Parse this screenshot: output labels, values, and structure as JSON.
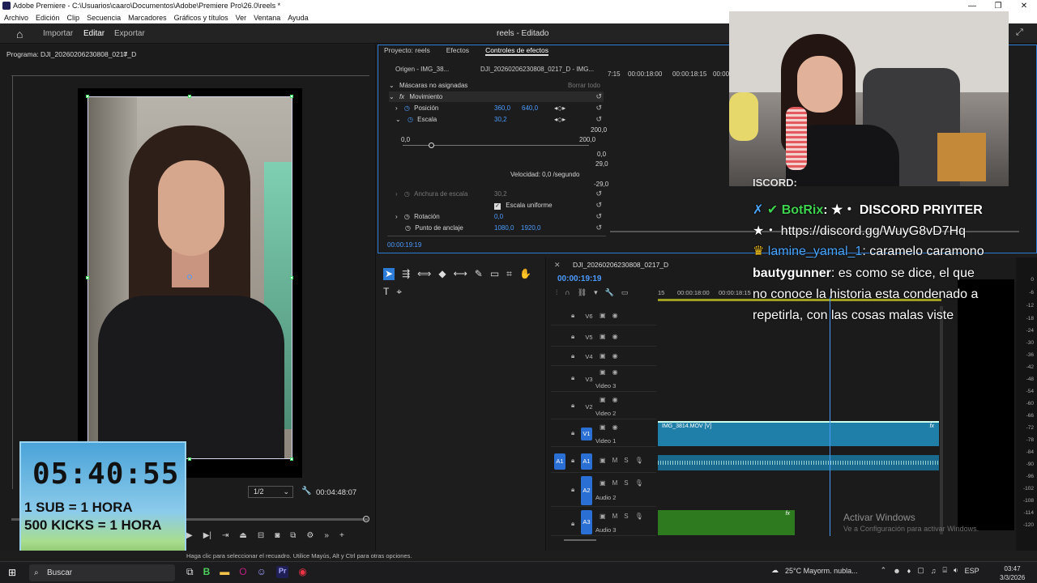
{
  "window": {
    "title": "Adobe Premiere - C:\\Usuarios\\caaro\\Documentos\\Adobe\\Premiere Pro\\26.0\\reels *"
  },
  "menu": [
    "Archivo",
    "Edición",
    "Clip",
    "Secuencia",
    "Marcadores",
    "Gráficos y títulos",
    "Ver",
    "Ventana",
    "Ayuda"
  ],
  "header": {
    "tabs": [
      "Importar",
      "Editar",
      "Exportar"
    ],
    "active": "Editar",
    "project": "reels - Editado"
  },
  "program": {
    "title": "Programa: DJI_20260206230808_0217_D",
    "fit_value": "1/2",
    "timecode": "00:04:48:07"
  },
  "timer_overlay": {
    "clock": "05:40:55",
    "line1": "1 SUB = 1 HORA",
    "line2": "500 KICKS = 1 HORA"
  },
  "status_text": "Haga clic para seleccionar el recuadro. Utilice Mayús, Alt y Ctrl para otras opciones.",
  "effects": {
    "tabs": [
      "Proyecto: reels",
      "Efectos",
      "Controles de efectos"
    ],
    "source_label": "Origen - IMG_38...",
    "sequence_label": "DJI_20260206230808_0217_D - IMG...",
    "masks_label": "Máscaras no asignadas",
    "clear_all": "Borrar todo",
    "motion": "Movimiento",
    "position_label": "Posición",
    "position_x": "360,0",
    "position_y": "640,0",
    "scale_label": "Escala",
    "scale_value": "30,2",
    "scale_max": "200,0",
    "slider_min": "0,0",
    "slider_max": "200,0",
    "v1": "0,0",
    "v2": "29,0",
    "v3": "-29,0",
    "speed": "Velocidad: 0,0 /segundo",
    "width_label": "Anchura de escala",
    "width_value": "30,2",
    "uniform_label": "Escala uniforme",
    "rotation_label": "Rotación",
    "rotation_value": "0,0",
    "anchor_label": "Punto de anclaje",
    "anchor_x": "1080,0",
    "anchor_y": "1920,0",
    "timecode": "00:00:19:19",
    "ruler": [
      "7:15",
      "00:00:18:00",
      "00:00:18:15",
      "00:00"
    ]
  },
  "timeline": {
    "title": "DJI_20260206230808_0217_D",
    "timecode": "00:00:19:19",
    "ruler": [
      "15",
      "00:00:18:00",
      "00:00:18:15"
    ],
    "tracks": [
      {
        "id": "V6",
        "name": ""
      },
      {
        "id": "V5",
        "name": ""
      },
      {
        "id": "V4",
        "name": ""
      },
      {
        "id": "V3",
        "name": "Video 3"
      },
      {
        "id": "V2",
        "name": "Video 2"
      },
      {
        "id": "V1",
        "name": "Video 1"
      },
      {
        "id": "A1",
        "name": ""
      },
      {
        "id": "A2",
        "name": "Audio 2"
      },
      {
        "id": "A3",
        "name": "Audio 3"
      }
    ],
    "clip_v1": "IMG_3814.MOV [V]"
  },
  "meter_ticks": [
    "0",
    "-6",
    "-12",
    "-18",
    "-24",
    "-30",
    "-36",
    "-42",
    "-48",
    "-54",
    "-60",
    "-66",
    "-72",
    "-78",
    "-84",
    "-90",
    "-96",
    "-102",
    "-108",
    "-114",
    "-120"
  ],
  "chat": {
    "line0": "ISCORD:",
    "bot_user": "BotRix",
    "bot_msg": ": ★・ DISCORD PRIYITER",
    "bot_link": "★・ https://discord.gg/WuyG8vD7Hq",
    "user2": "lamine_yamal_1",
    "msg2": ": caramelo caramono",
    "user3": "bautygunner",
    "msg3a": ": es como se dice, el que",
    "msg3b": "no conoce la historia esta condenado a",
    "msg3c": "repetirla, con las cosas malas viste"
  },
  "watermark": {
    "line1": "Activar Windows",
    "line2": "Ve a Configuración para activar Windows."
  },
  "taskbar": {
    "search": "Buscar",
    "weather": "25°C  Mayorm. nubla...",
    "lang": "ESP",
    "time": "03:47",
    "date": "3/3/2026"
  },
  "colors": {
    "accent": "#2c7bd6",
    "timecode": "#4b9bff",
    "video_clip": "#1f7fa8",
    "audio_clip_a3": "#2d7b1e"
  }
}
